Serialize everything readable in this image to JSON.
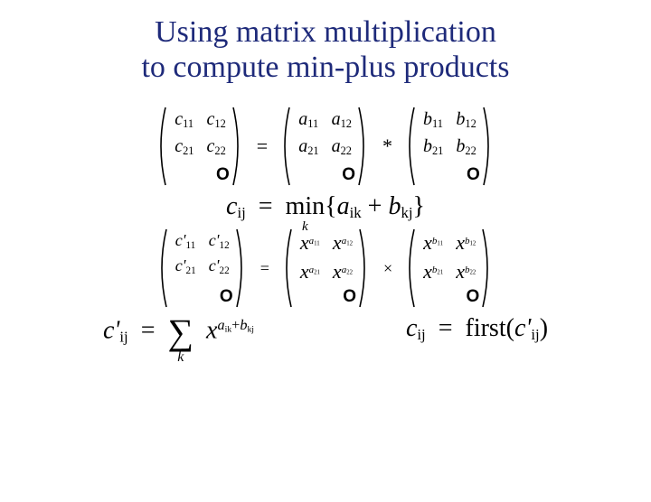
{
  "title_line1": "Using matrix multiplication",
  "title_line2": "to compute min-plus products",
  "matrices": {
    "C": [
      [
        "c",
        "11"
      ],
      [
        "c",
        "12"
      ],
      [
        "c",
        "21"
      ],
      [
        "c",
        "22"
      ]
    ],
    "A": [
      [
        "a",
        "11"
      ],
      [
        "a",
        "12"
      ],
      [
        "a",
        "21"
      ],
      [
        "a",
        "22"
      ]
    ],
    "B": [
      [
        "b",
        "11"
      ],
      [
        "b",
        "12"
      ],
      [
        "b",
        "21"
      ],
      [
        "b",
        "22"
      ]
    ],
    "Cp": [
      [
        "c'",
        "11"
      ],
      [
        "c'",
        "12"
      ],
      [
        "c'",
        "21"
      ],
      [
        "c'",
        "22"
      ]
    ],
    "XA": [
      [
        "x",
        "a",
        "11"
      ],
      [
        "x",
        "a",
        "12"
      ],
      [
        "x",
        "a",
        "21"
      ],
      [
        "x",
        "a",
        "22"
      ]
    ],
    "XB": [
      [
        "x",
        "b",
        "11"
      ],
      [
        "x",
        "b",
        "12"
      ],
      [
        "x",
        "b",
        "21"
      ],
      [
        "x",
        "b",
        "22"
      ]
    ],
    "corner": "O"
  },
  "ops": {
    "eq": "=",
    "star": "*",
    "times": "×"
  },
  "formulas": {
    "cij": "c",
    "cij_sub": "ij",
    "min": "min",
    "min_sub": "k",
    "lbrace": "{",
    "rbrace": "}",
    "aik": "a",
    "aik_sub": "ik",
    "plus": "+",
    "bkj": "b",
    "bkj_sub": "kj",
    "cpij": "c'",
    "cpij_sub": "ij",
    "sum_sub": "k",
    "x": "x",
    "exp_a": "a",
    "exp_a_sub": "ik",
    "exp_b": "b",
    "exp_b_sub": "kj",
    "first": "first",
    "lparen": "(",
    "rparen": ")"
  }
}
